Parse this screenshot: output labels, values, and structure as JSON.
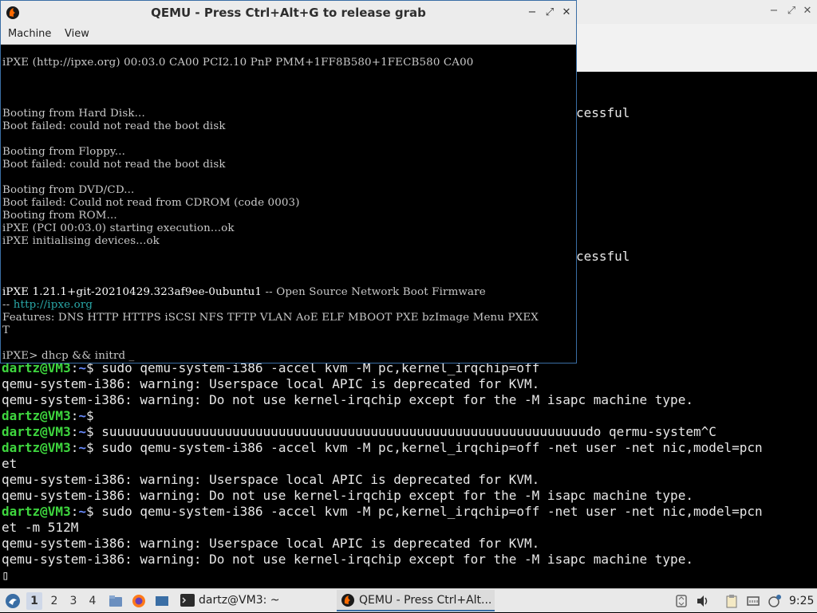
{
  "terminal": {
    "partial_lines": [
      "cessful",
      "cessful"
    ],
    "prompt_user": "dartz@VM3",
    "prompt_path": "~",
    "lines": [
      {
        "prompt": true,
        "text": " sudo qemu-system-i386 -accel kvm -M pc,kernel_irqchip=off"
      },
      {
        "prompt": false,
        "text": "qemu-system-i386: warning: Userspace local APIC is deprecated for KVM."
      },
      {
        "prompt": false,
        "text": "qemu-system-i386: warning: Do not use kernel-irqchip except for the -M isapc machine type."
      },
      {
        "prompt": true,
        "text": ""
      },
      {
        "prompt": true,
        "text": " suuuuuuuuuuuuuuuuuuuuuuuuuuuuuuuuuuuuuuuuuuuuuuuuuuuuuuuuuuuuuudo qermu-system^C"
      },
      {
        "prompt": true,
        "text": " sudo qemu-system-i386 -accel kvm -M pc,kernel_irqchip=off -net user -net nic,model=pcn"
      },
      {
        "prompt": false,
        "text": "et"
      },
      {
        "prompt": false,
        "text": "qemu-system-i386: warning: Userspace local APIC is deprecated for KVM."
      },
      {
        "prompt": false,
        "text": "qemu-system-i386: warning: Do not use kernel-irqchip except for the -M isapc machine type."
      },
      {
        "prompt": true,
        "text": " sudo qemu-system-i386 -accel kvm -M pc,kernel_irqchip=off -net user -net nic,model=pcn"
      },
      {
        "prompt": false,
        "text": "et -m 512M"
      },
      {
        "prompt": false,
        "text": "qemu-system-i386: warning: Userspace local APIC is deprecated for KVM."
      },
      {
        "prompt": false,
        "text": "qemu-system-i386: warning: Do not use kernel-irqchip except for the -M isapc machine type."
      },
      {
        "prompt": false,
        "text": "▯"
      }
    ]
  },
  "qemu": {
    "title": "QEMU - Press Ctrl+Alt+G to release grab",
    "menu": [
      "Machine",
      "View"
    ],
    "controls": {
      "minimize": "−",
      "restore": "⤢",
      "close": "✕"
    },
    "screen": {
      "header": "iPXE (http://ipxe.org) 00:03.0 CA00 PCI2.10 PnP PMM+1FF8B580+1FECB580 CA00",
      "boot_lines": [
        "Booting from Hard Disk...",
        "Boot failed: could not read the boot disk",
        "",
        "Booting from Floppy...",
        "Boot failed: could not read the boot disk",
        "",
        "Booting from DVD/CD...",
        "Boot failed: Could not read from CDROM (code 0003)",
        "Booting from ROM...",
        "iPXE (PCI 00:03.0) starting execution...ok",
        "iPXE initialising devices...ok"
      ],
      "version": "iPXE 1.21.1+git-20210429.323af9ee-0ubuntu1",
      "version_suffix": " -- Open Source Network Boot Firmware",
      "url_prefix": "-- ",
      "url": "http://ipxe.org",
      "features": "Features: DNS HTTP HTTPS iSCSI NFS TFTP VLAN AoE ELF MBOOT PXE bzImage Menu PXEX",
      "features_wrap": "T",
      "command_prompt": "iPXE> dhcp && initrd _"
    }
  },
  "taskbar": {
    "workspaces": [
      "1",
      "2",
      "3",
      "4"
    ],
    "active_workspace": "1",
    "tasks": [
      {
        "label": "dartz@VM3: ~",
        "icon": "terminal-icon"
      },
      {
        "label": "QEMU - Press Ctrl+Alt...",
        "icon": "qemu-icon"
      }
    ],
    "clock": "9:25"
  }
}
